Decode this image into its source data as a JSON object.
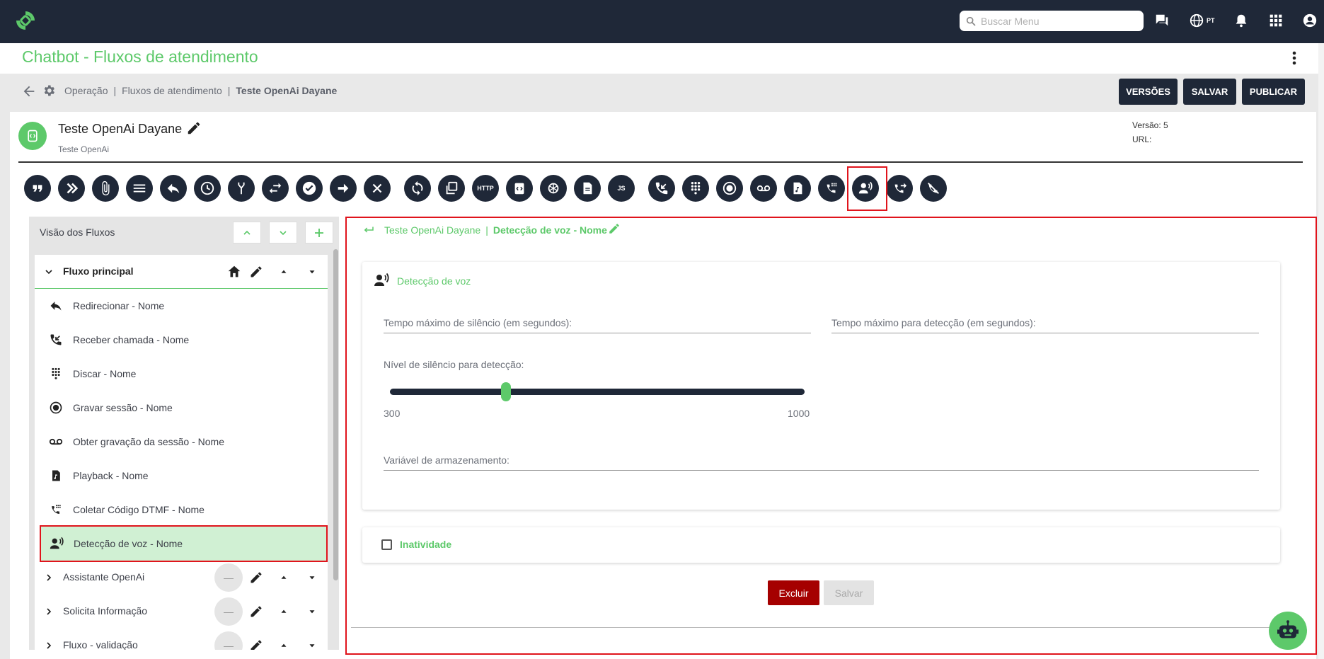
{
  "topbar": {
    "search_placeholder": "Buscar Menu",
    "lang": "PT",
    "icons": [
      "logo-icon",
      "search-icon",
      "chat-icon",
      "globe-icon",
      "alarm-icon",
      "apps-grid-icon",
      "account-icon"
    ]
  },
  "page": {
    "title": "Chatbot - Fluxos de atendimento"
  },
  "breadcrumb": {
    "items": [
      "Operação",
      "Fluxos de atendimento"
    ],
    "current": "Teste OpenAi Dayane"
  },
  "actions": {
    "versions": "VERSÕES",
    "save": "SALVAR",
    "publish": "PUBLICAR"
  },
  "flow": {
    "name": "Teste OpenAi Dayane",
    "subtitle": "Teste OpenAi",
    "version": "Versão: 5",
    "url": "URL:"
  },
  "toolbar": {
    "tools": [
      "quote-icon",
      "double-chevron-icon",
      "attachment-icon",
      "menu-lines-icon",
      "reply-icon",
      "clock-icon",
      "branch-icon",
      "swap-icon",
      "check-icon",
      "arrow-right-icon",
      "close-icon",
      "sync-icon",
      "copy-icon",
      "http-icon",
      "code-icon",
      "openai-icon",
      "document-icon",
      "javascript-icon",
      "incoming-call-icon",
      "dialpad-icon",
      "record-icon",
      "voicemail-icon",
      "playback-icon",
      "dtmf-icon",
      "voice-detect-icon",
      "forward-call-icon",
      "hangup-icon"
    ],
    "http_label": "HTTP",
    "js_label": "JS",
    "highlighted": "voice-detect-icon"
  },
  "sidebar": {
    "title": "Visão dos Fluxos",
    "main_flow": "Fluxo principal",
    "items": [
      {
        "label": "Redirecionar - Nome",
        "icon": "reply-icon"
      },
      {
        "label": "Receber chamada - Nome",
        "icon": "incoming-call-icon"
      },
      {
        "label": "Discar - Nome",
        "icon": "dialpad-icon"
      },
      {
        "label": "Gravar sessão - Nome",
        "icon": "record-icon"
      },
      {
        "label": "Obter gravação da sessão - Nome",
        "icon": "voicemail-icon"
      },
      {
        "label": "Playback - Nome",
        "icon": "playback-icon"
      },
      {
        "label": "Coletar Código DTMF - Nome",
        "icon": "dtmf-icon"
      },
      {
        "label": "Detecção de voz - Nome",
        "icon": "voice-detect-icon",
        "selected": true
      }
    ],
    "sub_flows": [
      "Assistante OpenAi",
      "Solicita Informação",
      "Fluxo - validação"
    ],
    "sub_flow_badge": "—"
  },
  "editor": {
    "crumb_flow": "Teste OpenAi Dayane",
    "crumb_node": "Detecção de voz - Nome",
    "section_title": "Detecção de voz",
    "field_max_silence": "Tempo máximo de silêncio (em segundos):",
    "field_max_detection": "Tempo máximo para detecção (em segundos):",
    "slider_label": "Nível de silêncio para detecção:",
    "slider_min": "300",
    "slider_max": "1000",
    "slider_value_fraction": 0.28,
    "field_storage_var": "Variável de armazenamento:",
    "inactivity_label": "Inatividade",
    "inactivity_checked": false,
    "delete_label": "Excluir",
    "save_label": "Salvar"
  },
  "colors": {
    "dark": "#1f2838",
    "accent": "#5dc96a",
    "danger": "#a50000",
    "highlight": "#e0141c"
  }
}
